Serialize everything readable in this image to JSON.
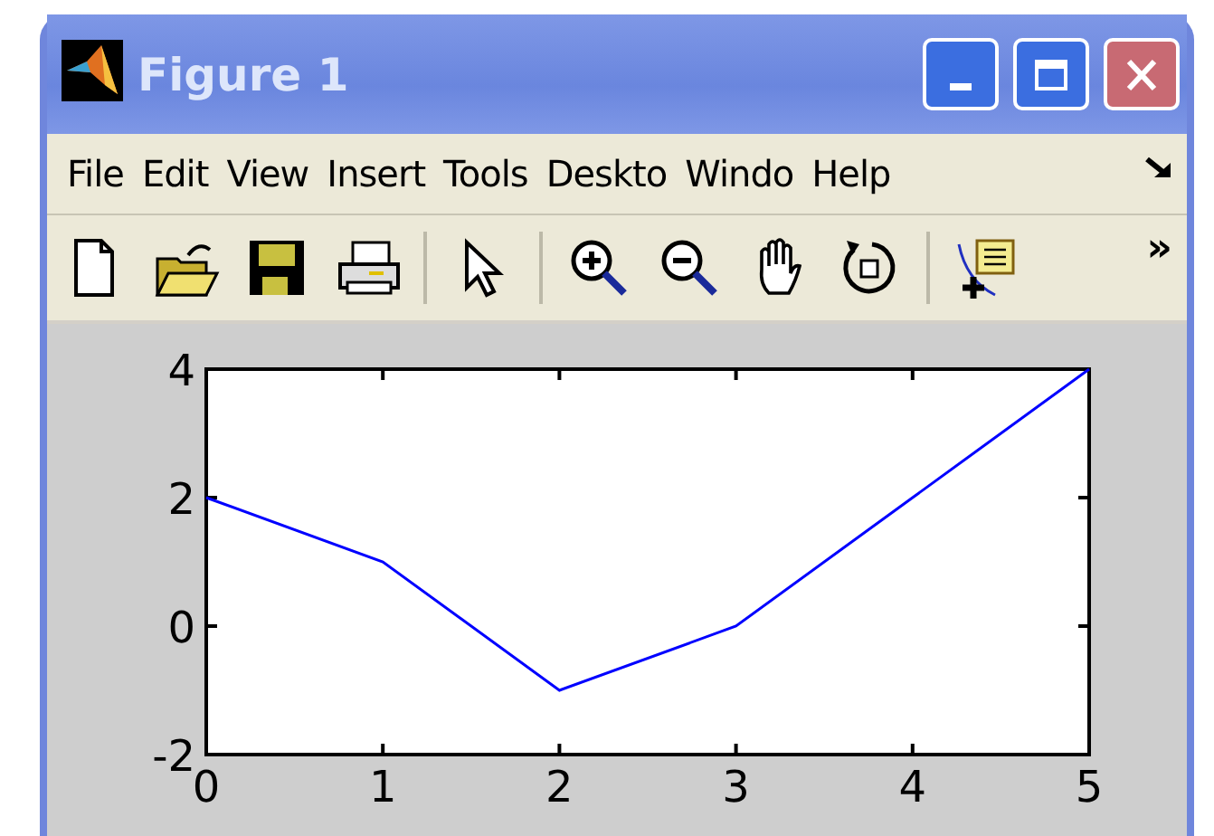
{
  "window": {
    "title": "Figure 1"
  },
  "menu": [
    {
      "label": "File"
    },
    {
      "label": "Edit"
    },
    {
      "label": "View"
    },
    {
      "label": "Insert"
    },
    {
      "label": "Tools"
    },
    {
      "label": "Deskto"
    },
    {
      "label": "Windo"
    },
    {
      "label": "Help"
    }
  ],
  "toolbar": {
    "items": [
      {
        "kind": "new"
      },
      {
        "kind": "open"
      },
      {
        "kind": "save"
      },
      {
        "kind": "print"
      },
      {
        "kind": "sep"
      },
      {
        "kind": "pointer"
      },
      {
        "kind": "sep"
      },
      {
        "kind": "zoomin"
      },
      {
        "kind": "zoomout"
      },
      {
        "kind": "pan"
      },
      {
        "kind": "rotate"
      },
      {
        "kind": "sep"
      },
      {
        "kind": "cursor"
      }
    ],
    "overflow": "»"
  },
  "plot": {
    "chart_data": {
      "type": "line",
      "x": [
        0,
        1,
        2,
        3,
        4,
        5
      ],
      "series": [
        {
          "color": "#0000ff",
          "values": [
            2,
            1,
            -1,
            0,
            2,
            4
          ]
        }
      ],
      "xlim": [
        0,
        5
      ],
      "ylim": [
        -2,
        4
      ],
      "xticks": [
        0,
        1,
        2,
        3,
        4,
        5
      ],
      "yticks": [
        -2,
        0,
        2,
        4
      ]
    }
  }
}
